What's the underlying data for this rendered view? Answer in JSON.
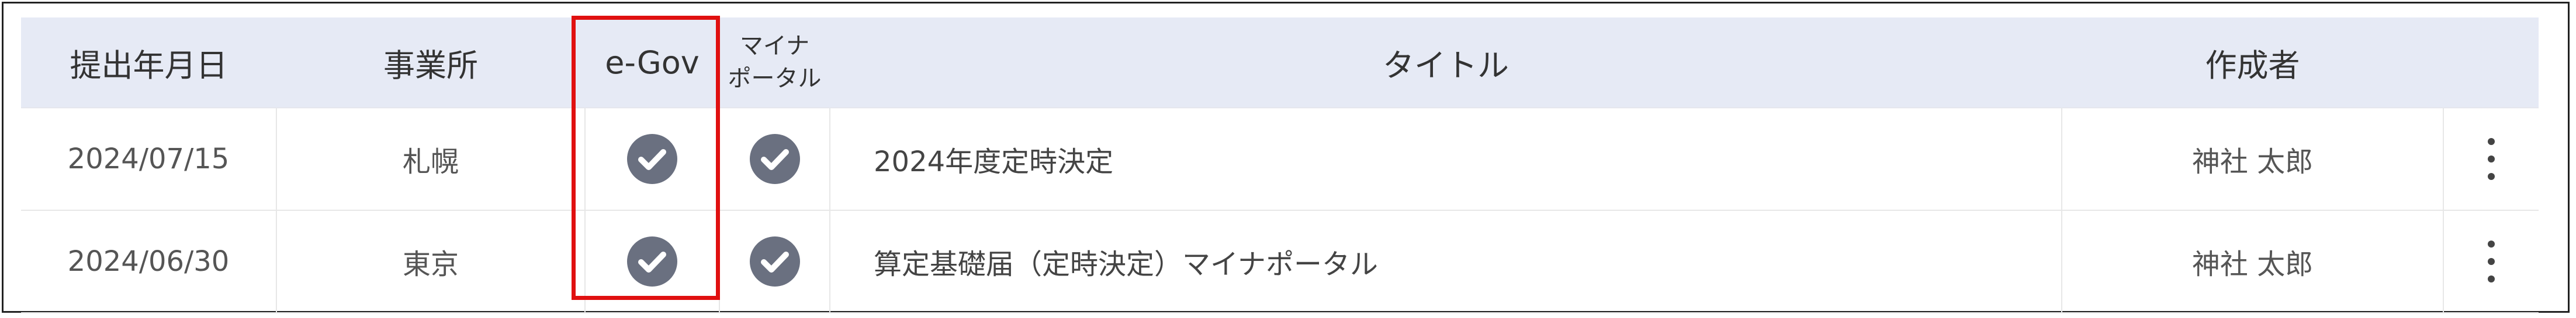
{
  "columns": {
    "date": "提出年月日",
    "office": "事業所",
    "egov": "e-Gov",
    "myna_line1": "マイナ",
    "myna_line2": "ポータル",
    "title": "タイトル",
    "author": "作成者"
  },
  "rows": [
    {
      "date": "2024/07/15",
      "office": "札幌",
      "egov_status": "check-circle-icon",
      "myna_status": "check-circle-icon",
      "title": "2024年度定時決定",
      "author": "神社 太郎"
    },
    {
      "date": "2024/06/30",
      "office": "東京",
      "egov_status": "check-circle-icon",
      "myna_status": "check-circle-icon",
      "title": "算定基礎届（定時決定）マイナポータル",
      "author": "神社 太郎"
    }
  ],
  "colors": {
    "header_bg": "#e6eaf5",
    "check_icon": "#6a7080",
    "highlight": "#e01010"
  }
}
